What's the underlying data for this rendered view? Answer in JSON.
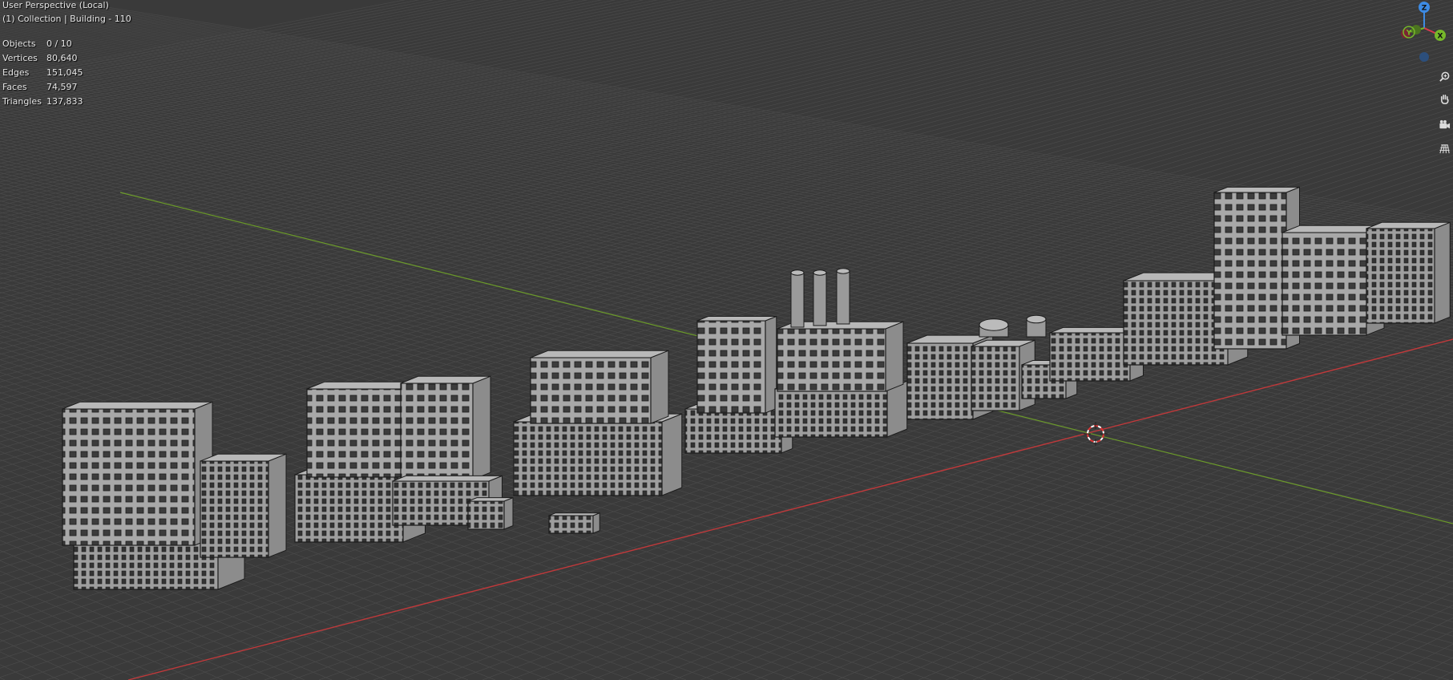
{
  "viewport": {
    "view_name": "User Perspective (Local)",
    "collection_name": "(1) Collection | Building - 110"
  },
  "stats": [
    {
      "label": "Objects",
      "value": "0 / 10"
    },
    {
      "label": "Vertices",
      "value": "80,640"
    },
    {
      "label": "Edges",
      "value": "151,045"
    },
    {
      "label": "Faces",
      "value": "74,597"
    },
    {
      "label": "Triangles",
      "value": "137,833"
    }
  ],
  "gizmo": {
    "z_label": "Z",
    "y_label": "Y",
    "x_label": "X",
    "colors": {
      "x": "#d8394f",
      "y": "#76b82a",
      "z": "#3d8be4"
    }
  },
  "nav_buttons": [
    {
      "icon": "zoom-icon"
    },
    {
      "icon": "hand-pan-icon"
    },
    {
      "icon": "camera-icon"
    },
    {
      "icon": "grid-ortho-icon"
    }
  ],
  "colors": {
    "background": "#3a3a3a",
    "x_axis": "#c0393b",
    "y_axis": "#6b9a2a",
    "building_fill": "#a8a8a8",
    "building_shade": "#8c8c8c",
    "wire": "#1c1c1c"
  }
}
